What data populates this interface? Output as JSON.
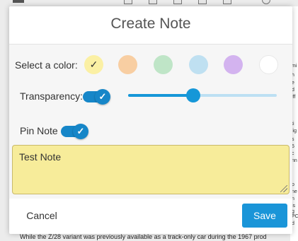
{
  "background": {
    "fragments": [
      "mi",
      "h",
      "e",
      "d",
      "iff",
      "ti",
      "lig",
      "s",
      "6",
      "c",
      "nn",
      "p",
      "ne",
      "n",
      "is",
      "g",
      "PC",
      "d"
    ],
    "bottom_text": "While the Z/28 variant was previously available as a track-only car during the 1967 prod"
  },
  "modal": {
    "title": "Create Note",
    "color_label": "Select a color:",
    "colors": [
      {
        "name": "yellow",
        "hex": "#fbf0a4",
        "selected": true,
        "check": "✓"
      },
      {
        "name": "orange",
        "hex": "#f8cea2",
        "selected": false,
        "check": ""
      },
      {
        "name": "green",
        "hex": "#bfe5c7",
        "selected": false,
        "check": ""
      },
      {
        "name": "blue",
        "hex": "#bfe0f1",
        "selected": false,
        "check": ""
      },
      {
        "name": "purple",
        "hex": "#d3b3ef",
        "selected": false,
        "check": ""
      },
      {
        "name": "white",
        "hex": "#ffffff",
        "selected": false,
        "check": ""
      }
    ],
    "transparency_label": "Transparency:",
    "transparency_enabled": true,
    "transparency_level": 0.44,
    "pin_label": "Pin Note",
    "pin_enabled": true,
    "toggle_check": "✓",
    "note_text": "Test Note",
    "cancel_label": "Cancel",
    "save_label": "Save"
  },
  "colors": {
    "accent": "#1697d8",
    "toggle_track": "#1686c8"
  }
}
